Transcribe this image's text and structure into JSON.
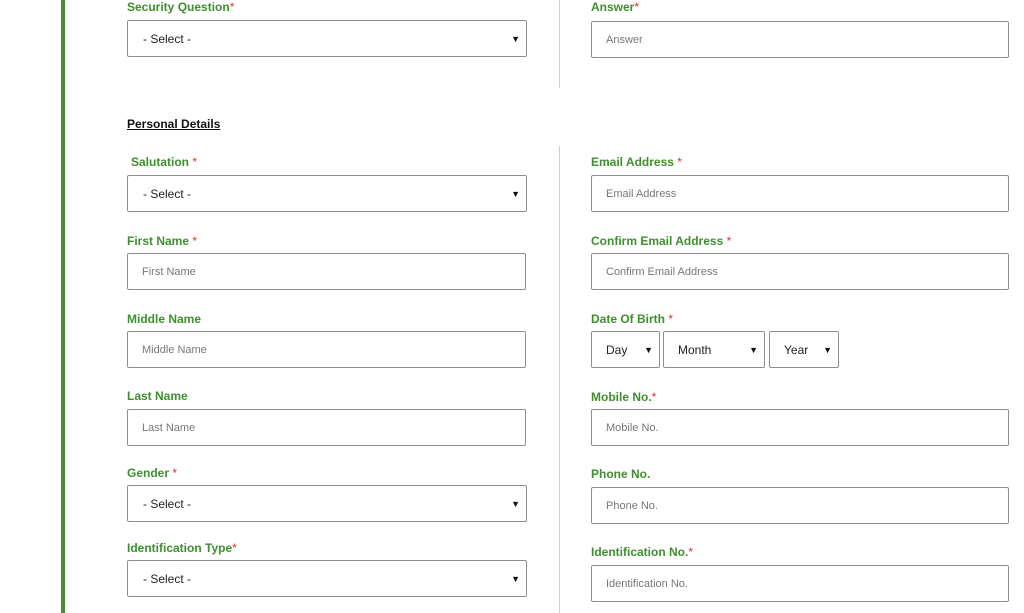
{
  "security": {
    "question_label": "Security Question",
    "question_required": "*",
    "question_value": "- Select -",
    "answer_label": "Answer",
    "answer_required": "*",
    "answer_placeholder": "Answer"
  },
  "personal_details": {
    "title": "Personal Details",
    "salutation": {
      "label": "Salutation",
      "required": "*",
      "value": "- Select -"
    },
    "first_name": {
      "label": "First Name",
      "required": "*",
      "placeholder": "First Name"
    },
    "middle_name": {
      "label": "Middle Name",
      "placeholder": "Middle Name"
    },
    "last_name": {
      "label": "Last Name",
      "placeholder": "Last Name"
    },
    "gender": {
      "label": "Gender",
      "required": "*",
      "value": "- Select -"
    },
    "identification_type": {
      "label": "Identification Type",
      "required": "*",
      "value": "- Select -"
    },
    "email": {
      "label": "Email Address",
      "required": "*",
      "placeholder": "Email Address"
    },
    "confirm_email": {
      "label": "Confirm Email Address",
      "required": "*",
      "placeholder": "Confirm Email Address"
    },
    "dob": {
      "label": "Date Of Birth",
      "required": "*",
      "day": "Day",
      "month": "Month",
      "year": "Year"
    },
    "mobile": {
      "label": "Mobile No.",
      "required": "*",
      "placeholder": "Mobile No."
    },
    "phone": {
      "label": "Phone No.",
      "placeholder": "Phone No."
    },
    "identification_no": {
      "label": "Identification No.",
      "required": "*",
      "placeholder": "Identification No."
    }
  },
  "icons": {
    "dropdown": "caret-down-icon"
  },
  "colors": {
    "label_green": "#3f8f2f",
    "required_red": "#d9322b",
    "accent_bar": "#4a8c3b"
  }
}
